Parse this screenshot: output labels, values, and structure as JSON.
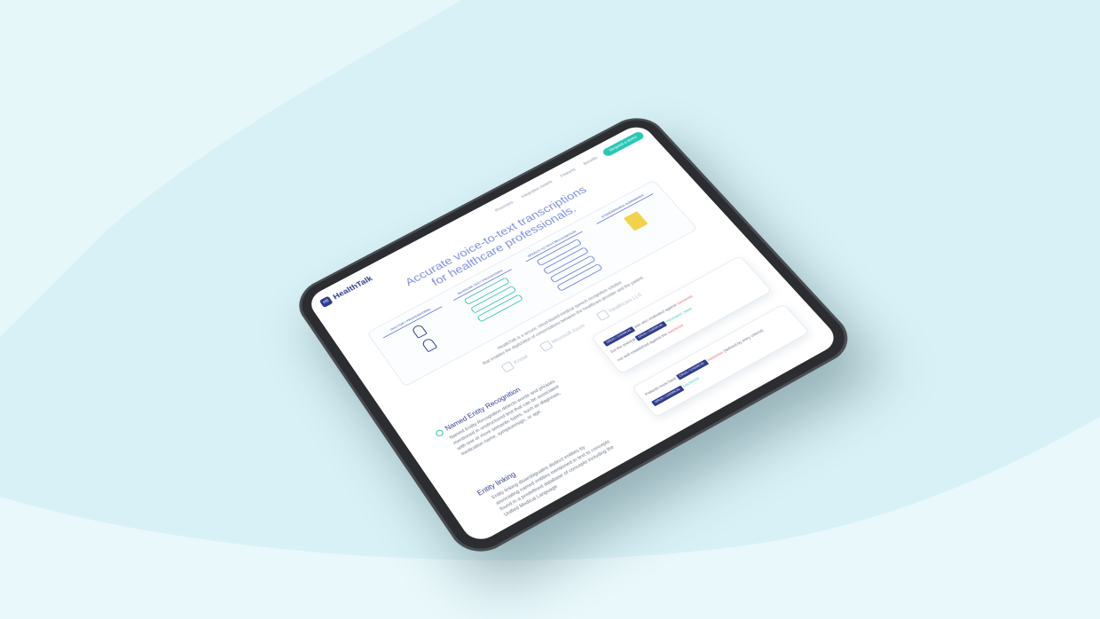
{
  "app": {
    "logo_mark": "ntt",
    "logo_text": "HealthTalk"
  },
  "nav": {
    "links": [
      "Processes",
      "Integration models",
      "Features",
      "Benefits"
    ],
    "cta_label": "Request a demo"
  },
  "hero": {
    "title_line1": "Accurate voice-to-text transcriptions",
    "title_line2": "for healthcare professionals."
  },
  "diagram": {
    "columns": [
      "DOCTOR / PROFESSIONAL",
      "IN-HOUSE TEXT PROCESSING",
      "SPEECH TO TEXT RECOGNITION",
      "STANDARDIZED SUMMARIES"
    ]
  },
  "description": {
    "line1": "HealthTalk is a secure, cloud-based medical speech recognition solution",
    "line2": "that enables the digitization of conversations between the healthcare provider and the patient."
  },
  "partners": [
    "Knowl",
    "Microsoft Azure",
    "Healthcare LLC"
  ],
  "features": {
    "ner": {
      "title": "Named Entity Recognition",
      "body": "Named Entity Recognition detects words and phrases mentioned in unstructured text that can be associated with one or more semantic types, such as diagnosis, medication name, symptom/sign, or age."
    },
    "linking": {
      "title": "Entity linking",
      "body": "Entity linking disambiguates distinct entities by associating named entities mentioned in text to concepts found in a predefined database of concepts including the Unified Medical Language"
    }
  },
  "ner_card": {
    "line1_text": "was also evaluated against",
    "line1_tag": "DRUG / CHEMICAL",
    "line1_label": "DIAGNOSIS",
    "line2_text": "but the antiviral",
    "line2_tag": "DRUG / CHEMICAL",
    "line2_label": "TREATMENT_NAME",
    "line3_text": "not well established against the",
    "line3_label": "DIAGNOSIS"
  },
  "link_card": {
    "line1_text": "Patients must have",
    "line1_tag": "DRUG / CHEMICAL",
    "line1_label": "DIAGNOSIS",
    "line2_text": "(defined by entry criteria)",
    "line3_tag": "DRUG / CHEMICAL",
    "line3_label": "DIAGNOSIS"
  },
  "colors": {
    "background": "#d8f1f6",
    "brand": "#2f3c8f",
    "accent": "#29c8b6",
    "highlight": "#e2566b"
  }
}
